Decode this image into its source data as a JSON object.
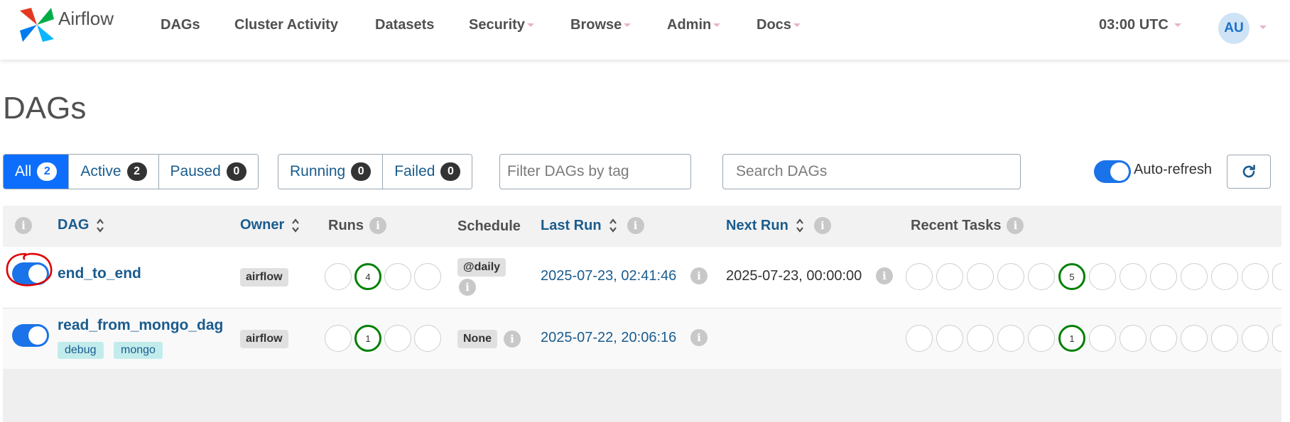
{
  "app": {
    "brand": "Airflow"
  },
  "nav": {
    "dags": "DAGs",
    "cluster_activity": "Cluster Activity",
    "datasets": "Datasets",
    "security": "Security",
    "browse": "Browse",
    "admin": "Admin",
    "docs": "Docs"
  },
  "header": {
    "time": "03:00 UTC",
    "user_initials": "AU"
  },
  "page": {
    "title": "DAGs"
  },
  "filters": {
    "all": {
      "label": "All",
      "count": "2"
    },
    "active": {
      "label": "Active",
      "count": "2"
    },
    "paused": {
      "label": "Paused",
      "count": "0"
    },
    "running": {
      "label": "Running",
      "count": "0"
    },
    "failed": {
      "label": "Failed",
      "count": "0"
    },
    "tag_placeholder": "Filter DAGs by tag",
    "search_placeholder": "Search DAGs",
    "auto_refresh_label": "Auto-refresh",
    "auto_refresh_on": true
  },
  "table": {
    "columns": {
      "dag": "DAG",
      "owner": "Owner",
      "runs": "Runs",
      "schedule": "Schedule",
      "last_run": "Last Run",
      "next_run": "Next Run",
      "recent_tasks": "Recent Tasks"
    },
    "rows": [
      {
        "enabled": true,
        "dag_id": "end_to_end",
        "tags": [],
        "owner": "airflow",
        "runs": [
          "",
          "4",
          "",
          ""
        ],
        "schedule": "@daily",
        "last_run": "2025-07-23, 02:41:46",
        "next_run": "2025-07-23, 00:00:00",
        "recent_tasks": [
          "",
          "",
          "",
          "",
          "",
          "5",
          "",
          "",
          "",
          "",
          "",
          "",
          ""
        ]
      },
      {
        "enabled": true,
        "dag_id": "read_from_mongo_dag",
        "tags": [
          "debug",
          "mongo"
        ],
        "owner": "airflow",
        "runs": [
          "",
          "1",
          "",
          ""
        ],
        "schedule": "None",
        "last_run": "2025-07-22, 20:06:16",
        "next_run": "",
        "recent_tasks": [
          "",
          "",
          "",
          "",
          "",
          "1",
          "",
          "",
          "",
          "",
          "",
          "",
          ""
        ]
      }
    ]
  },
  "colors": {
    "primary": "#0d6efd",
    "link": "#1a5c8e",
    "success": "#008000",
    "annotation": "#e00000"
  },
  "icons": {
    "brand": "airflow-pinwheel-icon",
    "refresh": "refresh-icon",
    "info": "info-icon",
    "sort": "sort-icon"
  }
}
